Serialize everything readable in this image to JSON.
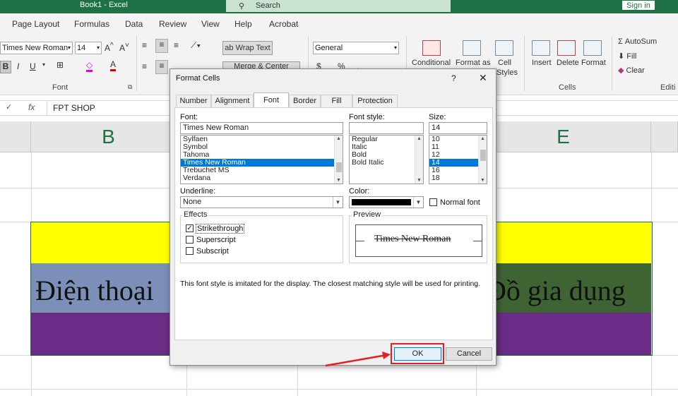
{
  "window": {
    "title": "Book1 - Excel",
    "search_placeholder": "Search",
    "sign_in": "Sign in"
  },
  "ribbon": {
    "tabs": [
      "Page Layout",
      "Formulas",
      "Data",
      "Review",
      "View",
      "Help",
      "Acrobat"
    ],
    "font_name": "Times New Roman",
    "font_size": "14",
    "font_group_label": "Font",
    "wrap_text": "Wrap Text",
    "merge_center": "Merge & Center",
    "number_format": "General",
    "conditional": "Conditional",
    "format_as": "Format as",
    "cell_styles": "Cell",
    "styles_sub": "Styles",
    "insert": "Insert",
    "delete": "Delete",
    "format": "Format",
    "cells_group_label": "Cells",
    "autosum": "AutoSum",
    "fill": "Fill",
    "clear": "Clear",
    "editing_label": "Editi"
  },
  "formula_bar": {
    "fx": "fx",
    "content": "FPT SHOP"
  },
  "sheet": {
    "columns": [
      "B",
      "E"
    ],
    "cell_left": "Điện thoại",
    "cell_right": "Đồ gia dụng",
    "colors": {
      "yellow": "#ffff00",
      "blue": "#7b8fb8",
      "green": "#3f6433",
      "purple": "#6a2c86"
    }
  },
  "dialog": {
    "title": "Format Cells",
    "help": "?",
    "close": "✕",
    "tabs": [
      "Number",
      "Alignment",
      "Font",
      "Border",
      "Fill",
      "Protection"
    ],
    "font_label": "Font:",
    "font_value": "Times New Roman",
    "font_list": [
      "Sylfaen",
      "Symbol",
      "Tahoma",
      "Times New Roman",
      "Trebuchet MS",
      "Verdana"
    ],
    "style_label": "Font style:",
    "style_list": [
      "Regular",
      "Italic",
      "Bold",
      "Bold Italic"
    ],
    "size_label": "Size:",
    "size_value": "14",
    "size_list": [
      "10",
      "11",
      "12",
      "14",
      "16",
      "18"
    ],
    "underline_label": "Underline:",
    "underline_value": "None",
    "color_label": "Color:",
    "normal_font": "Normal font",
    "effects_label": "Effects",
    "effects": [
      "Strikethrough",
      "Superscript",
      "Subscript"
    ],
    "preview_label": "Preview",
    "preview_text": "Times New Roman",
    "note": "This font style is imitated for the display.  The closest matching style will be used for printing.",
    "ok": "OK",
    "cancel": "Cancel"
  }
}
